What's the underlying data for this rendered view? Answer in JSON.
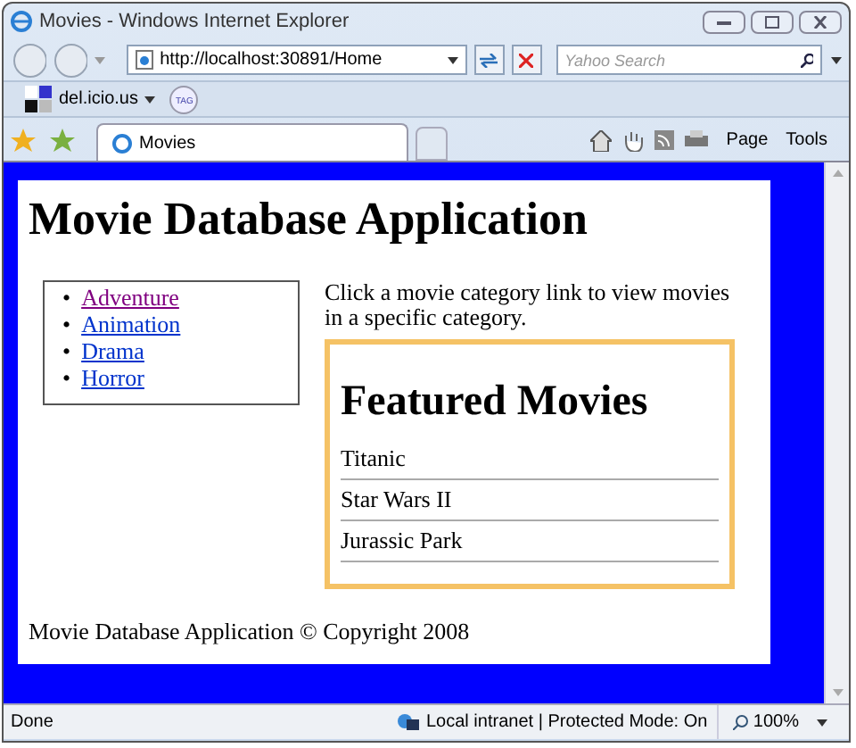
{
  "window": {
    "title": "Movies - Windows Internet Explorer"
  },
  "address_bar": {
    "value": "http://localhost:30891/Home"
  },
  "search": {
    "placeholder": "Yahoo Search"
  },
  "links_bar": {
    "label": "del.icio.us",
    "tag_icon": "TAG"
  },
  "tabs": [
    {
      "label": "Movies",
      "selected": true
    }
  ],
  "command_bar": [
    "Page",
    "Tools"
  ],
  "page": {
    "heading": "Movie Database Application",
    "categories": [
      {
        "marker": "•",
        "label": "Adventure",
        "visited": true
      },
      {
        "marker": "•",
        "label": "Animation",
        "visited": false
      },
      {
        "marker": "•",
        "label": "Drama",
        "visited": false
      },
      {
        "marker": "•",
        "label": "Horror",
        "visited": false
      }
    ],
    "intro": "Click a movie category link to view movies in a specific category.",
    "featured": {
      "title": "Featured Movies",
      "movies": [
        "Titanic",
        "Star Wars II",
        "Jurassic Park"
      ]
    },
    "footer": "Movie Database Application © Copyright 2008"
  },
  "status_bar": {
    "status": "Done",
    "zone": "Local intranet | Protected Mode: On",
    "zoom": "100%"
  }
}
